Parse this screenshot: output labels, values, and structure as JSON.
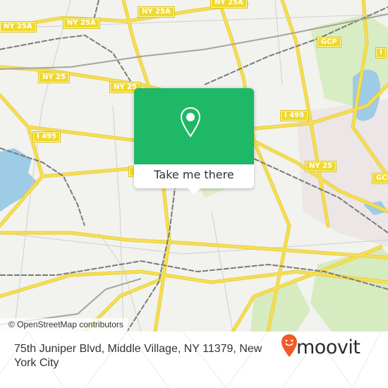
{
  "map": {
    "road_labels": [
      {
        "id": "ny25a-left",
        "text": "NY 25A"
      },
      {
        "id": "ny25a-mid",
        "text": "NY 25A"
      },
      {
        "id": "ny25a-top-right",
        "text": "NY 25A"
      },
      {
        "id": "ny25a-top",
        "text": "NY 25A"
      },
      {
        "id": "ny25-left",
        "text": "NY 25"
      },
      {
        "id": "ny25-mid",
        "text": "NY 25"
      },
      {
        "id": "ny25-right",
        "text": "NY 25"
      },
      {
        "id": "i495-left",
        "text": "I 495"
      },
      {
        "id": "i495-right",
        "text": "I 495"
      },
      {
        "id": "gcp-top",
        "text": "GCP"
      },
      {
        "id": "gcp-right",
        "text": "GCP"
      },
      {
        "id": "i-right-edge",
        "text": "I"
      }
    ],
    "attribution": "© OpenStreetMap contributors",
    "colors": {
      "road": "#f5df55",
      "rail": "#777777",
      "park": "#d7ebc1",
      "water": "#9ecbe6",
      "land": "#f2f2ee"
    }
  },
  "popup": {
    "icon": "map-pin-icon",
    "button_label": "Take me there",
    "color": "#1fb866"
  },
  "footer": {
    "address": "75th Juniper Blvd, Middle Village, NY 11379, New York City",
    "brand": "moovit",
    "brand_color": "#f05a28"
  }
}
